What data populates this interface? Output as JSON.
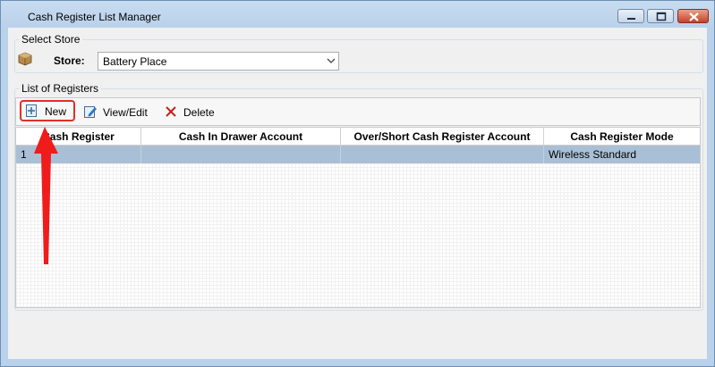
{
  "window": {
    "title": "Cash Register List Manager"
  },
  "select_store": {
    "group_title": "Select Store",
    "store_label": "Store:",
    "store_value": "Battery Place"
  },
  "registers": {
    "group_title": "List of Registers",
    "toolbar": {
      "new_label": "New",
      "view_edit_label": "View/Edit",
      "delete_label": "Delete"
    },
    "columns": [
      "Cash Register",
      "Cash In Drawer Account",
      "Over/Short Cash Register Account",
      "Cash Register Mode"
    ],
    "rows": [
      {
        "cash_register": "1",
        "cash_in_drawer": "",
        "over_short": "",
        "mode": "Wireless Standard"
      }
    ]
  },
  "colors": {
    "highlight": "#e0302a",
    "selected_row": "#a9bfd6",
    "title_bar": "#b9d1ea"
  }
}
